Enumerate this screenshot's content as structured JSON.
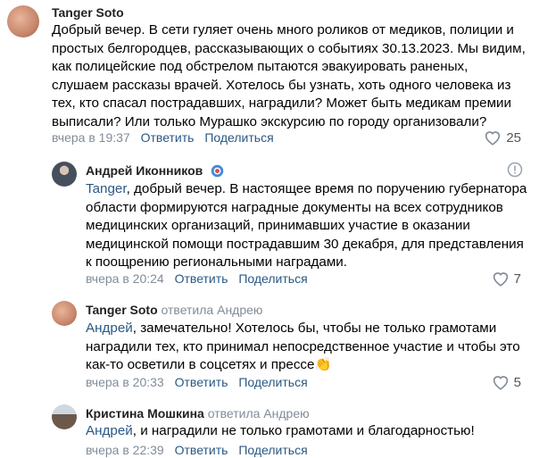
{
  "comments": [
    {
      "author": "Tanger Soto",
      "reply_to": "",
      "mention": "",
      "lines": [
        "Добрый вечер. В сети гуляет очень много роликов от медиков, полиции и",
        "простых белгородцев, рассказывающих о событиях 30.13.2023. Мы видим,",
        "как полицейские под обстрелом пытаются эвакуировать раненых,",
        "слушаем рассказы врачей. Хотелось бы узнать, хоть одного человека из",
        "тех, кто спасал пострадавших, наградили? Может быть медикам премии",
        "выписали? Или только Мурашко экскурсию по городу организовали?"
      ],
      "time": "вчера в 19:37",
      "reply_label": "Ответить",
      "share_label": "Поделиться",
      "likes": "25"
    },
    {
      "author": "Андрей Иконников",
      "reply_to": "",
      "mention": "Tanger",
      "lines": [
        ", добрый вечер. В настоящее время по поручению губернатора",
        "области формируются наградные документы на всех сотрудников",
        "медицинских организаций, принимавших участие в оказании",
        "медицинской помощи пострадавшим 30 декабря, для представления",
        "к поощрению региональными наградами."
      ],
      "time": "вчера в 20:24",
      "reply_label": "Ответить",
      "share_label": "Поделиться",
      "likes": "7"
    },
    {
      "author": "Tanger Soto",
      "reply_to": "ответила Андрею",
      "mention": "Андрей",
      "lines": [
        ", замечательно! Хотелось бы, чтобы не только грамотами",
        "наградили тех, кто принимал непосредственное участие и чтобы это",
        "как-то осветили в соцсетях и прессе"
      ],
      "emoji": "👏",
      "time": "вчера в 20:33",
      "reply_label": "Ответить",
      "share_label": "Поделиться",
      "likes": "5"
    },
    {
      "author": "Кристина Мошкина",
      "reply_to": "ответила Андрею",
      "mention": "Андрей",
      "lines": [
        ", и наградили не только грамотами и благодарностью!"
      ],
      "time": "вчера в 22:39",
      "reply_label": "Ответить",
      "share_label": "Поделиться",
      "likes": ""
    }
  ],
  "colors": {
    "link": "#2a5885",
    "secondary": "#818c99",
    "badge": "#3f8ae0"
  },
  "icons": [
    "heart-icon",
    "verified-badge-icon",
    "warning-icon",
    "clap-emoji"
  ]
}
